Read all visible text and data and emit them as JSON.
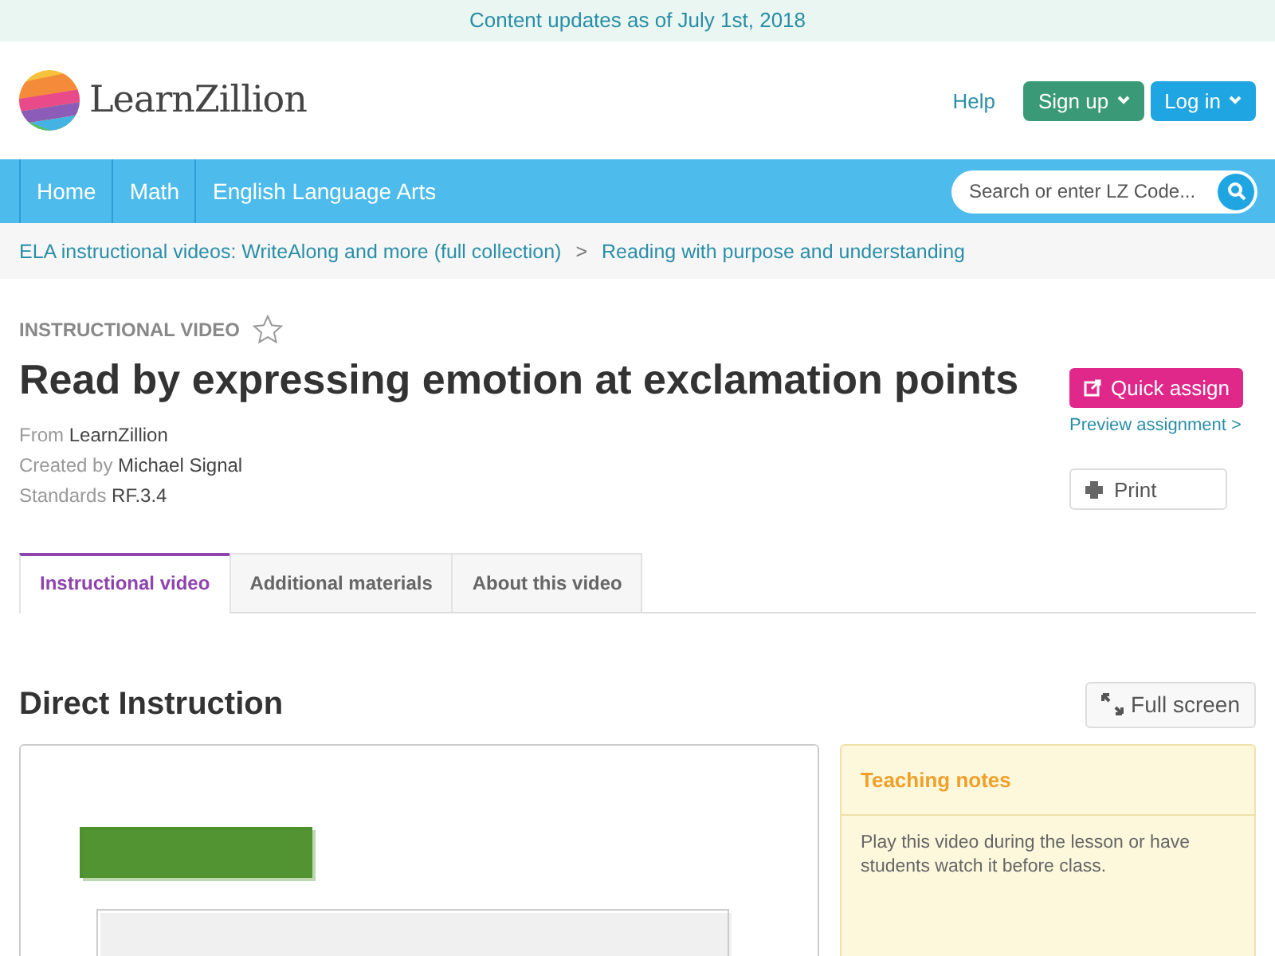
{
  "banner": "Content updates as of July 1st, 2018",
  "header": {
    "logo": "LearnZillion",
    "help": "Help",
    "buttons": [
      {
        "label": "Sign up",
        "kind": "signup"
      },
      {
        "label": "Log in",
        "kind": "login"
      }
    ]
  },
  "nav": {
    "items": [
      {
        "label": "Home"
      },
      {
        "label": "Math"
      },
      {
        "label": "English Language Arts"
      }
    ],
    "search": {
      "placeholder": "Search or enter LZ Code..."
    }
  },
  "breadcrumb": {
    "items": [
      "ELA instructional videos: WriteAlong and more (full collection)",
      "Reading with purpose and understanding"
    ],
    "separator": ">"
  },
  "lesson": {
    "type_label": "INSTRUCTIONAL VIDEO",
    "favorited": false,
    "title": "Read by expressing emotion at exclamation points",
    "meta": [
      {
        "label": "From",
        "value": "LearnZillion"
      },
      {
        "label": "Created by",
        "value": "Michael Signal"
      },
      {
        "label": "Standards",
        "value": "RF.3.4"
      }
    ],
    "quick_assign": "Quick assign",
    "preview": "Preview assignment >",
    "print": "Print"
  },
  "tabs": [
    {
      "label": "Instructional video",
      "selected": true
    },
    {
      "label": "Additional materials",
      "selected": false
    },
    {
      "label": "About this video",
      "selected": false
    }
  ],
  "section": {
    "title": "Direct Instruction",
    "fullscreen": "Full screen",
    "notes": {
      "title": "Teaching notes",
      "text": "Play this video during the lesson or have students watch it before class."
    }
  }
}
